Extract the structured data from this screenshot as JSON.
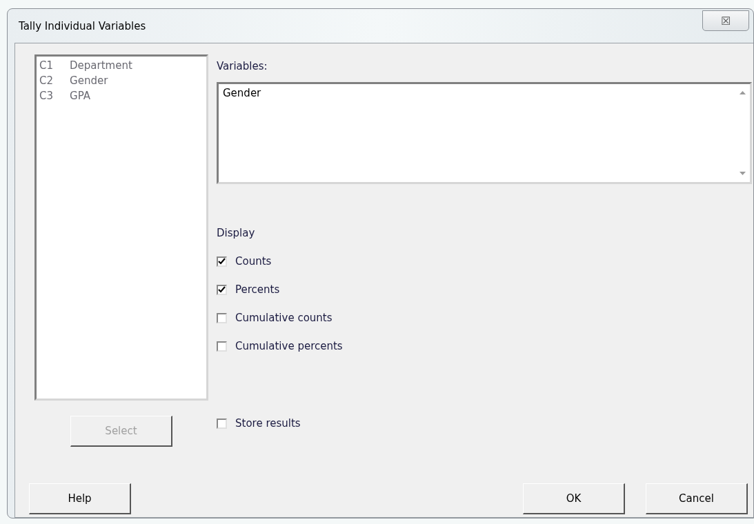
{
  "window": {
    "title": "Tally Individual Variables",
    "close_glyph": "☒"
  },
  "columns": [
    {
      "id": "C1",
      "name": "Department"
    },
    {
      "id": "C2",
      "name": "Gender"
    },
    {
      "id": "C3",
      "name": "GPA"
    }
  ],
  "select_button": {
    "label": "Select",
    "disabled": true
  },
  "variables": {
    "label": "Variables:",
    "value": "Gender"
  },
  "display": {
    "label": "Display",
    "options": [
      {
        "label": "Counts",
        "checked": true
      },
      {
        "label": "Percents",
        "checked": true
      },
      {
        "label": "Cumulative counts",
        "checked": false
      },
      {
        "label": "Cumulative percents",
        "checked": false
      }
    ]
  },
  "store_results": {
    "label": "Store results",
    "checked": false
  },
  "buttons": [
    {
      "label": "Help",
      "kind": "left"
    },
    {
      "label": "OK",
      "kind": "right"
    },
    {
      "label": "Cancel",
      "kind": "right"
    }
  ]
}
